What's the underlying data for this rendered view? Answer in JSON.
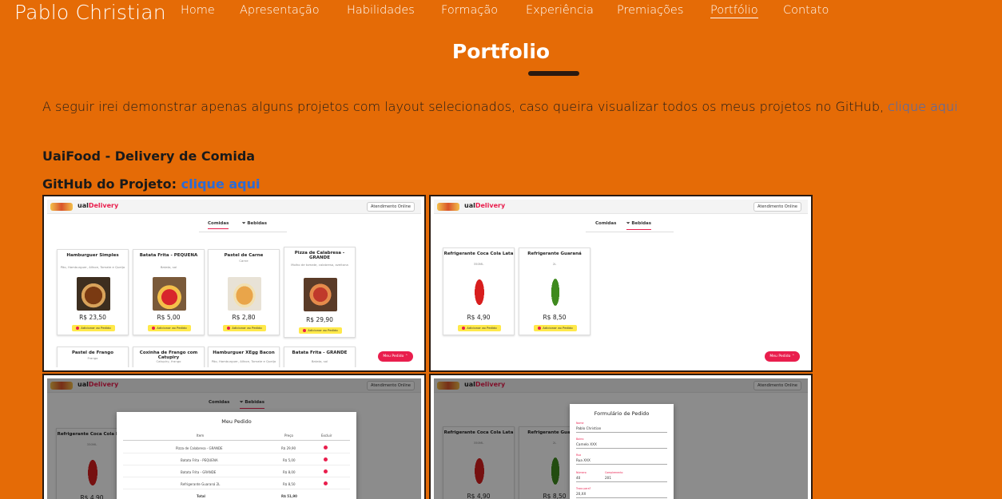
{
  "header": {
    "brand": "Pablo Christian",
    "nav": [
      "Home",
      "Apresentação",
      "Habilidades",
      "Formação",
      "Experiência",
      "Premiações",
      "Portfólio",
      "Contato"
    ],
    "active_nav": "Portfólio"
  },
  "section": {
    "title": "Portfolio",
    "intro_text": "A seguir irei demonstrar apenas alguns projetos com layout selecionados, caso queira visualizar todos os meus projetos no GitHub, ",
    "intro_link": "clique aqui"
  },
  "project": {
    "title": "UaiFood - Delivery de Comida",
    "github_label": "GitHub do Projeto: ",
    "github_link": "clique aqui"
  },
  "screens": {
    "app_logo_prefix": "ual",
    "app_logo_suffix": "Delivery",
    "atendimento": "Atendimento Online",
    "tab_comidas": "Comidas",
    "tab_bebidas": "Bebidas",
    "meu_pedido_btn": "Meu Pedido",
    "add_label": "Adicionar ao Pedido",
    "comidas": [
      {
        "name": "Hamburguer Simples",
        "desc": "Pão, Hamburguer, Alface, Tomate e Queijo",
        "price": "R$ 23,50"
      },
      {
        "name": "Batata Frita - PEQUENA",
        "desc": "Batata, sal",
        "price": "R$ 5,00"
      },
      {
        "name": "Pastel de Carne",
        "desc": "Carne",
        "price": "R$ 2,80"
      },
      {
        "name": "Pizza de Calabresa - GRANDE",
        "desc": "Molho de tomate, calabresa, azeitona",
        "price": "R$ 29,90"
      }
    ],
    "comidas_row2": [
      {
        "name": "Pastel de Frango",
        "desc": "Frango"
      },
      {
        "name": "Coxinha de Frango com Catupiry",
        "desc": "Catupiry, frango"
      },
      {
        "name": "Hamburguer XEgg Bacon",
        "desc": "Pão, Hamburguer, Alface, Tomate e Queijo"
      },
      {
        "name": "Batata Frita - GRANDE",
        "desc": "Batata, sal"
      }
    ],
    "bebidas": [
      {
        "name": "Refrigerante Coca Cola Lata",
        "desc": "350ML",
        "price": "R$ 4,90"
      },
      {
        "name": "Refrigerante Guaraná",
        "desc": "2L",
        "price": "R$ 8,50"
      }
    ],
    "pedido_modal": {
      "title": "Meu Pedido",
      "headers": [
        "Item",
        "Preço",
        "Excluir"
      ],
      "rows": [
        {
          "item": "Pizza de Calabresa - GRANDE",
          "price": "R$ 29,90"
        },
        {
          "item": "Batata Frita - PEQUENA",
          "price": "R$ 5,00"
        },
        {
          "item": "Batata Frita - GRANDE",
          "price": "R$ 8,00"
        },
        {
          "item": "Refrigerante Guaraná 2L",
          "price": "R$ 8,50"
        }
      ],
      "total_label": "Total",
      "total_value": "R$ 51,90"
    },
    "form_modal": {
      "title": "Formulário de Pedido",
      "fields": [
        {
          "label": "Nome",
          "value": "Pablo Christian"
        },
        {
          "label": "Bairro",
          "value": "Camelo XXX"
        },
        {
          "label": "Rua",
          "value": "Rua XXX"
        },
        {
          "label": "Número",
          "value": "40"
        },
        {
          "label": "Complemento",
          "value": "201"
        },
        {
          "label": "Troco para?",
          "value": "20,XX"
        }
      ]
    }
  },
  "colors": {
    "background": "#e56b06",
    "link": "#2a6bd8",
    "accent": "#e91e4d"
  }
}
